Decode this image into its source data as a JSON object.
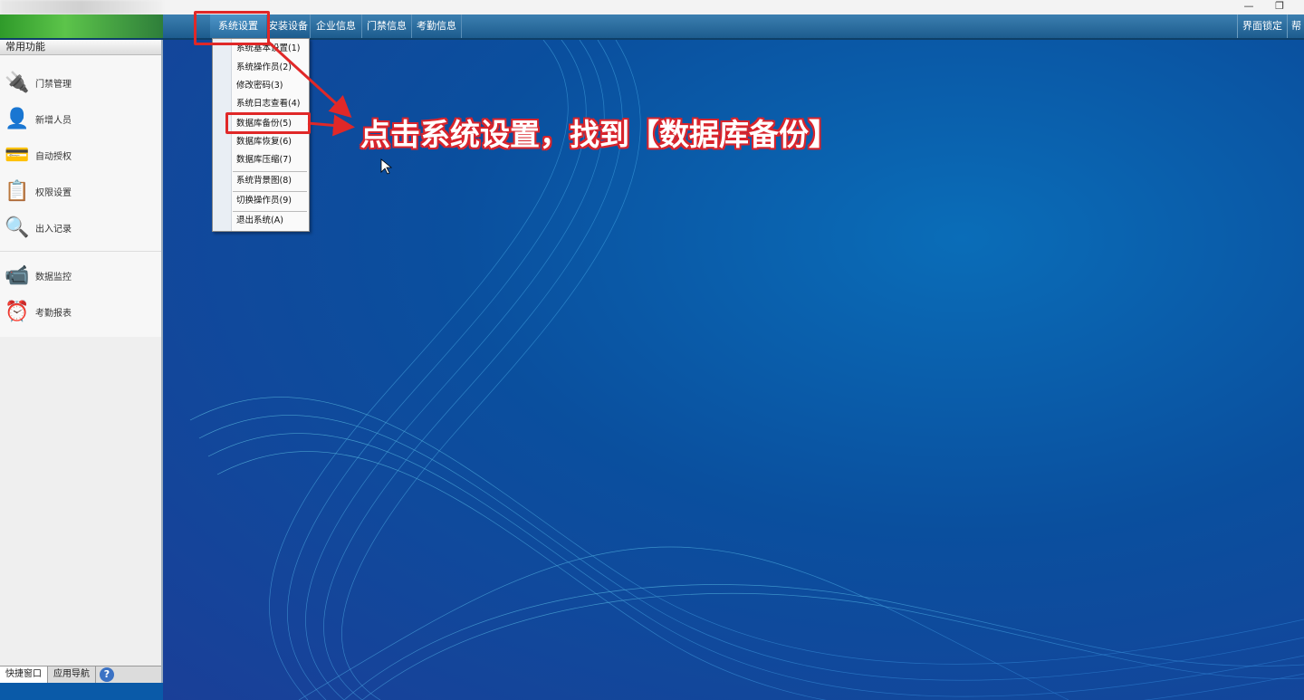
{
  "window": {
    "minimize": "—",
    "restore": "❐"
  },
  "menubar": {
    "items": [
      "系统设置",
      "安装设备",
      "企业信息",
      "门禁信息",
      "考勤信息"
    ],
    "active": "系统设置",
    "right_buttons": [
      "界面锁定",
      "帮"
    ]
  },
  "sidebar": {
    "header": "常用功能",
    "items": [
      {
        "label": "门禁管理",
        "icon": "door-access-icon"
      },
      {
        "label": "新增人员",
        "icon": "person-icon"
      },
      {
        "label": "自动授权",
        "icon": "card-icon"
      },
      {
        "label": "权限设置",
        "icon": "permission-icon"
      },
      {
        "label": "出入记录",
        "icon": "search-record-icon"
      },
      {
        "label": "数据监控",
        "icon": "camera-icon"
      },
      {
        "label": "考勤报表",
        "icon": "clock-icon"
      }
    ],
    "tabs": [
      "快捷窗口",
      "应用导航"
    ],
    "help": "?"
  },
  "dropdown": {
    "items": [
      "系统基本设置(1)",
      "系统操作员(2)",
      "修改密码(3)",
      "系统日志查看(4)",
      "数据库备份(5)",
      "数据库恢复(6)",
      "数据库压缩(7)",
      "系统背景图(8)",
      "切换操作员(9)",
      "退出系统(A)"
    ]
  },
  "annotation": {
    "caption": "点击系统设置，找到【数据库备份】",
    "color": "#e02828"
  }
}
